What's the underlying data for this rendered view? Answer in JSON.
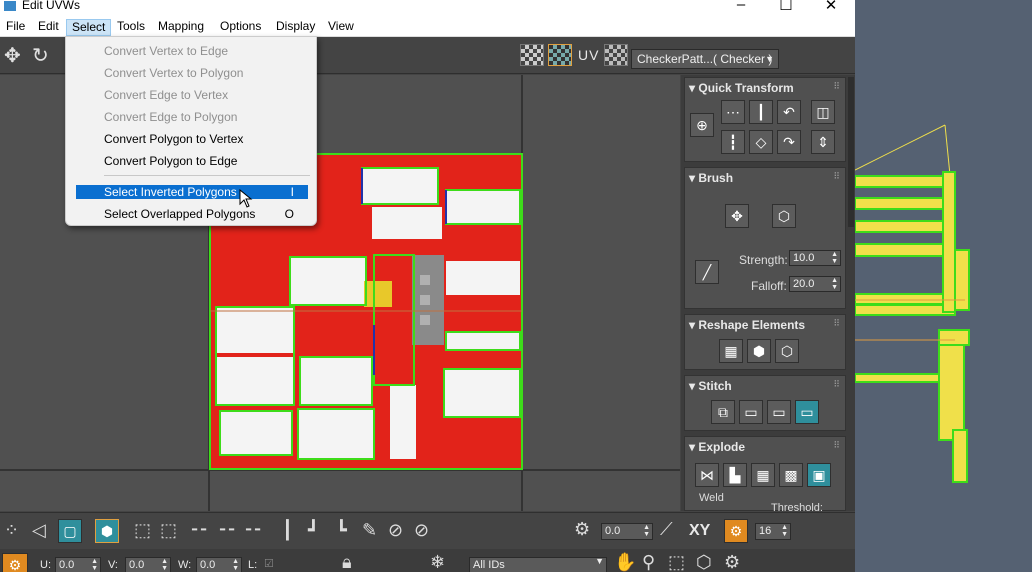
{
  "window": {
    "title": "Edit UVWs",
    "controls": [
      "minimize-icon",
      "maximize-icon",
      "close-icon"
    ]
  },
  "menubar": [
    "File",
    "Edit",
    "Select",
    "Tools",
    "Mapping",
    "Options",
    "Display",
    "View"
  ],
  "active_menu": "Select",
  "dropdown": {
    "items": [
      {
        "label": "Convert Vertex to Edge",
        "enabled": false,
        "shortcut": ""
      },
      {
        "label": "Convert Vertex to Polygon",
        "enabled": false,
        "shortcut": ""
      },
      {
        "label": "Convert Edge to Vertex",
        "enabled": false,
        "shortcut": ""
      },
      {
        "label": "Convert Edge to Polygon",
        "enabled": false,
        "shortcut": ""
      },
      {
        "label": "Convert Polygon to Vertex",
        "enabled": true,
        "shortcut": ""
      },
      {
        "label": "Convert Polygon to Edge",
        "enabled": true,
        "shortcut": ""
      },
      {
        "label": "Select Inverted Polygons",
        "enabled": true,
        "shortcut": "I",
        "highlighted": true
      },
      {
        "label": "Select Overlapped Polygons",
        "enabled": true,
        "shortcut": "O"
      }
    ]
  },
  "toolbar": {
    "uv_label": "UV",
    "texture_select": "CheckerPatt...( Checker )"
  },
  "panel": {
    "quick_transform": {
      "title": "Quick Transform"
    },
    "brush": {
      "title": "Brush",
      "strength_label": "Strength:",
      "strength_value": "10.0",
      "falloff_label": "Falloff:",
      "falloff_value": "20.0"
    },
    "reshape": {
      "title": "Reshape Elements"
    },
    "stitch": {
      "title": "Stitch"
    },
    "explode": {
      "title": "Explode",
      "weld_label": "Weld",
      "threshold_label": "Threshold:"
    }
  },
  "bottom": {
    "rotate_value": "0.0",
    "xy_label": "XY",
    "grid_value": "16",
    "u_label": "U:",
    "u_value": "0.0",
    "v_label": "V:",
    "v_value": "0.0",
    "w_label": "W:",
    "w_value": "0.0",
    "l_label": "L:",
    "id_select": "All IDs"
  },
  "colors": {
    "uv_red": "#e2231a",
    "uv_green": "#3ddc1a",
    "selection_blue": "#0a6fd0",
    "teal_button": "#2f8f9c",
    "object_yellow": "#f0e04a"
  }
}
